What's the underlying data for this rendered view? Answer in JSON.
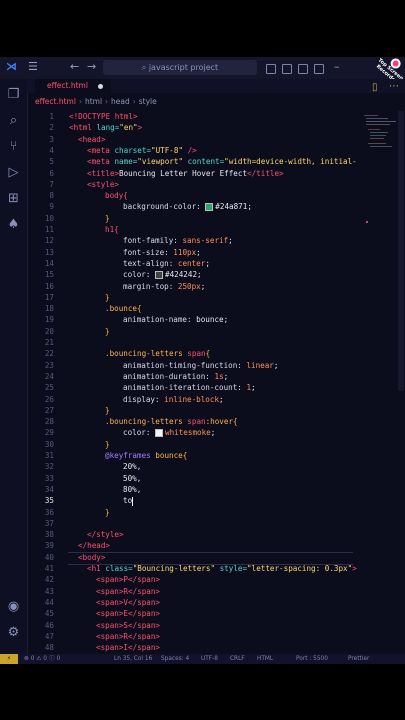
{
  "titlebar": {
    "search_text": "javascript project"
  },
  "badge": {
    "text": "Top Screen Recorder"
  },
  "tab": {
    "filename": "effect.html"
  },
  "breadcrumbs": [
    "effect.html",
    "html",
    "head",
    "style"
  ],
  "editor": {
    "current_line": "35",
    "lines": [
      {
        "n": "1"
      },
      {
        "n": "2"
      },
      {
        "n": "3"
      },
      {
        "n": "4"
      },
      {
        "n": "5"
      },
      {
        "n": "6"
      },
      {
        "n": "7"
      },
      {
        "n": "8"
      },
      {
        "n": "9"
      },
      {
        "n": "10"
      },
      {
        "n": "11"
      },
      {
        "n": "12"
      },
      {
        "n": "13"
      },
      {
        "n": "14"
      },
      {
        "n": "15"
      },
      {
        "n": "16"
      },
      {
        "n": "17"
      },
      {
        "n": "18"
      },
      {
        "n": "19"
      },
      {
        "n": "20"
      },
      {
        "n": "21"
      },
      {
        "n": "22"
      },
      {
        "n": "23"
      },
      {
        "n": "24"
      },
      {
        "n": "25"
      },
      {
        "n": "26"
      },
      {
        "n": "27"
      },
      {
        "n": "28"
      },
      {
        "n": "29"
      },
      {
        "n": "30"
      },
      {
        "n": "31"
      },
      {
        "n": "32"
      },
      {
        "n": "33"
      },
      {
        "n": "34"
      },
      {
        "n": "35"
      },
      {
        "n": "36"
      },
      {
        "n": "37"
      },
      {
        "n": "38"
      },
      {
        "n": "39"
      },
      {
        "n": "40"
      },
      {
        "n": "41"
      },
      {
        "n": "42"
      },
      {
        "n": "43"
      },
      {
        "n": "44"
      },
      {
        "n": "45"
      },
      {
        "n": "46"
      },
      {
        "n": "47"
      },
      {
        "n": "48"
      }
    ],
    "code": {
      "l1": "<!DOCTYPE html>",
      "l2a": "<html ",
      "l2b": "lang=",
      "l2c": "\"en\"",
      "l2d": ">",
      "l3": "<head>",
      "l4a": "<meta ",
      "l4b": "charset=",
      "l4c": "\"UTF-8\"",
      "l4d": " />",
      "l5a": "<meta ",
      "l5b": "name=",
      "l5c": "\"viewport\"",
      "l5d": " content=",
      "l5e": "\"width=device-width, initial-",
      "l6a": "<title>",
      "l6b": "Bouncing Letter Hover Effect",
      "l6c": "</title>",
      "l7": "<style>",
      "l8": "body{",
      "l9a": "background-color: ",
      "l9b": "#24a871",
      "l9c": ";",
      "l10": "}",
      "l11": "h1{",
      "l12a": "font-family: ",
      "l12b": "sans-serif",
      "l12c": ";",
      "l13a": "font-size: ",
      "l13b": "110px",
      "l13c": ";",
      "l14a": "text-align: ",
      "l14b": "center",
      "l14c": ";",
      "l15a": "color: ",
      "l15b": "#424242",
      "l15c": ";",
      "l16a": "margin-top: ",
      "l16b": "250px",
      "l16c": ";",
      "l17": "}",
      "l18": ".bounce{",
      "l19a": "animation-name: ",
      "l19b": "bounce",
      "l19c": ";",
      "l20": "}",
      "l22a": ".bouncing-letters ",
      "l22b": "span",
      "l22c": "{",
      "l23a": "animation-timing-function: ",
      "l23b": "linear",
      "l23c": ";",
      "l24a": "animation-duration: ",
      "l24b": "1s",
      "l24c": ";",
      "l25a": "animation-iteration-count: ",
      "l25b": "1",
      "l25c": ";",
      "l26a": "display: ",
      "l26b": "inline-block",
      "l26c": ";",
      "l27": "}",
      "l28a": ".bouncing-letters ",
      "l28b": "span",
      "l28c": ":hover{",
      "l29a": "color: ",
      "l29b": "whitesmoke",
      "l29c": ";",
      "l30": "}",
      "l31a": "@keyframes ",
      "l31b": "bounce",
      "l31c": "{",
      "l32": "20%,",
      "l33": "50%,",
      "l34": "80%,",
      "l35": "to",
      "l36": "}",
      "l37": "}",
      "l38": "</style>",
      "l39": "</head>",
      "l40": "<body>",
      "l41a": "<h1 ",
      "l41b": "class=",
      "l41c": "\"Bouncing-letters\"",
      "l41d": " style=",
      "l41e": "\"letter-spacing: 0.3px\"",
      "l41f": ">",
      "l42": "<span>P</span>",
      "l43": "<span>R</span>",
      "l44": "<span>V</span>",
      "l45": "<span>E</span>",
      "l46": "<span>S</span>",
      "l47": "<span>R</span>",
      "l48": "<span>I</span>"
    }
  },
  "status": {
    "errors": "0",
    "warnings": "0",
    "info": "0",
    "cursor": "Ln 35, Col 16",
    "spaces": "Spaces: 4",
    "encoding": "UTF-8",
    "eol": "CRLF",
    "language": "HTML",
    "port": "Port : 5500",
    "prettier": "Prettier"
  },
  "colors": {
    "swatch_bg": "#24a871",
    "swatch_color": "#424242",
    "swatch_ws": "#f5f5f5"
  }
}
